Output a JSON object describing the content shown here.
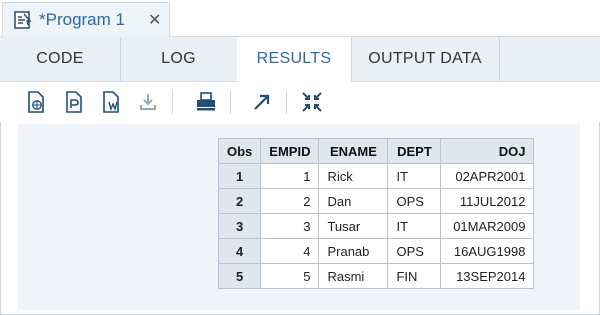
{
  "window": {
    "tab_title": "*Program 1",
    "close_symbol": "✕"
  },
  "section_tabs": [
    {
      "label": "CODE",
      "active": false
    },
    {
      "label": "LOG",
      "active": false
    },
    {
      "label": "RESULTS",
      "active": true
    },
    {
      "label": "OUTPUT DATA",
      "active": false
    }
  ],
  "toolbar": {
    "icons": [
      "html-download-icon",
      "pdf-download-icon",
      "word-download-icon",
      "download-icon",
      "print-icon",
      "open-new-window-icon",
      "collapse-icon"
    ]
  },
  "colors": {
    "accent": "#2b6aa3",
    "header_bg": "#dfe6ee",
    "pane_bg": "#f0f4f8"
  },
  "results_table": {
    "headers": [
      "Obs",
      "EMPID",
      "ENAME",
      "DEPT",
      "DOJ"
    ],
    "rows": [
      [
        "1",
        "1",
        "Rick",
        "IT",
        "02APR2001"
      ],
      [
        "2",
        "2",
        "Dan",
        "OPS",
        "11JUL2012"
      ],
      [
        "3",
        "3",
        "Tusar",
        "IT",
        "01MAR2009"
      ],
      [
        "4",
        "4",
        "Pranab",
        "OPS",
        "16AUG1998"
      ],
      [
        "5",
        "5",
        "Rasmi",
        "FIN",
        "13SEP2014"
      ]
    ]
  }
}
